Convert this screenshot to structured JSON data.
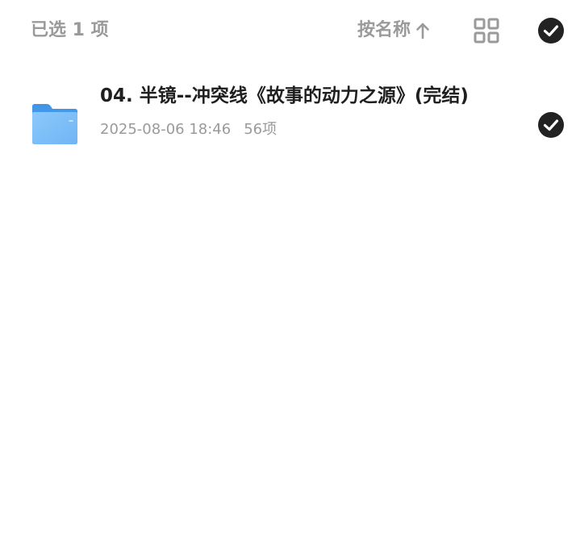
{
  "header": {
    "selected_text": "已选 1 项",
    "sort_label": "按名称",
    "sort_direction_icon": "arrow-up-icon",
    "view_toggle_icon": "grid-view-icon",
    "select_all_icon": "check-circle-icon",
    "select_all_checked": true
  },
  "files": [
    {
      "name": "04. 半镜--冲突线《故事的动力之源》(完结)",
      "date": "2025-08-06 18:46",
      "item_count": "56项",
      "type_icon": "folder-icon",
      "checked": true
    }
  ],
  "colors": {
    "text_primary": "#1f1f1f",
    "text_secondary": "#9a9a9a",
    "check_fill": "#222222",
    "folder_blue": "#5aa8ef"
  }
}
